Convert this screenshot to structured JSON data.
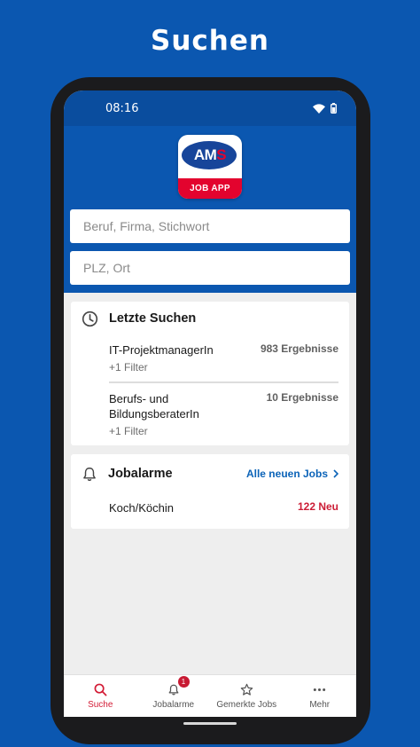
{
  "headline": "Suchen",
  "status": {
    "time": "08:16"
  },
  "logo": {
    "ams_a": "AM",
    "ams_s": "S",
    "tagline": "JOB APP"
  },
  "search": {
    "query_placeholder": "Beruf, Firma, Stichwort",
    "location_placeholder": "PLZ, Ort"
  },
  "recent": {
    "title": "Letzte Suchen",
    "items": [
      {
        "name": "IT-ProjektmanagerIn",
        "filter": "+1 Filter",
        "count": "983 Ergebnisse"
      },
      {
        "name": "Berufs- und BildungsberaterIn",
        "filter": "+1 Filter",
        "count": "10 Ergebnisse"
      }
    ]
  },
  "alarms": {
    "title": "Jobalarme",
    "link": "Alle neuen Jobs",
    "items": [
      {
        "name": "Koch/Köchin",
        "count": "122 Neu"
      }
    ]
  },
  "nav": {
    "items": [
      {
        "label": "Suche"
      },
      {
        "label": "Jobalarme",
        "badge": "1"
      },
      {
        "label": "Gemerkte Jobs"
      },
      {
        "label": "Mehr"
      }
    ]
  },
  "colors": {
    "brand_blue": "#0b57b0",
    "accent_red": "#d31c36",
    "link_blue": "#0b63b8"
  }
}
